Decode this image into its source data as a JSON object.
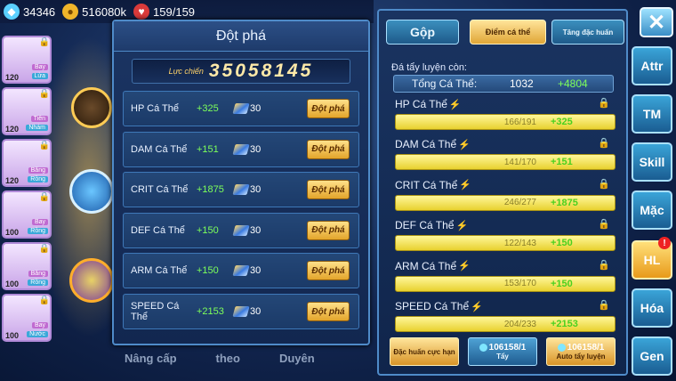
{
  "resources": {
    "gems": "34346",
    "gold": "516080k",
    "stamina": "159/159"
  },
  "pets": [
    {
      "level": "120",
      "tag1": "Bay",
      "tag2": "Lửa"
    },
    {
      "level": "120",
      "tag1": "Tiên",
      "tag2": "Nhám"
    },
    {
      "level": "120",
      "tag1": "Băng",
      "tag2": "Rồng"
    },
    {
      "level": "100",
      "tag1": "Bay",
      "tag2": "Rồng"
    },
    {
      "level": "100",
      "tag1": "Băng",
      "tag2": "Rồng"
    },
    {
      "level": "100",
      "tag1": "Bay",
      "tag2": "Nước"
    }
  ],
  "bottom_tabs": [
    "Nâng cấp",
    "theo",
    "Duyên"
  ],
  "breakthrough": {
    "title": "Đột phá",
    "power_label": "Lực chiến",
    "power_value": "35058145",
    "rows": [
      {
        "name": "HP Cá Thể",
        "bonus": "+325",
        "cost": "30",
        "button": "Đột phá"
      },
      {
        "name": "DAM Cá Thể",
        "bonus": "+151",
        "cost": "30",
        "button": "Đột phá"
      },
      {
        "name": "CRIT Cá Thể",
        "bonus": "+1875",
        "cost": "30",
        "button": "Đột phá"
      },
      {
        "name": "DEF Cá Thể",
        "bonus": "+150",
        "cost": "30",
        "button": "Đột phá"
      },
      {
        "name": "ARM Cá Thể",
        "bonus": "+150",
        "cost": "30",
        "button": "Đột phá"
      },
      {
        "name": "SPEED Cá Thể",
        "bonus": "+2153",
        "cost": "30",
        "button": "Đột phá"
      }
    ]
  },
  "training": {
    "tabs": {
      "gop": "Gộp",
      "diem": "Điểm cá thể",
      "tang": "Tăng đặc huấn"
    },
    "remaining_label": "Đá tẩy luyện còn:",
    "total_label": "Tổng Cá Thể:",
    "total_value": "1032",
    "total_bonus": "+4804",
    "stats": [
      {
        "name": "HP Cá Thể",
        "current": "166/191",
        "bonus": "+325"
      },
      {
        "name": "DAM Cá Thể",
        "current": "141/170",
        "bonus": "+151"
      },
      {
        "name": "CRIT Cá Thể",
        "current": "246/277",
        "bonus": "+1875"
      },
      {
        "name": "DEF Cá Thể",
        "current": "122/143",
        "bonus": "+150"
      },
      {
        "name": "ARM Cá Thể",
        "current": "153/170",
        "bonus": "+150"
      },
      {
        "name": "SPEED Cá Thể",
        "current": "204/233",
        "bonus": "+2153"
      }
    ],
    "buttons": {
      "dac_huan": "Đặc huấn cực hạn",
      "tay_count": "106158/1",
      "tay_label": "Tẩy",
      "auto_count": "106158/1",
      "auto_label": "Auto tẩy luyện"
    }
  },
  "side_menu": [
    "Attr",
    "TM",
    "Skill",
    "Mặc",
    "HL",
    "Hóa",
    "Gen"
  ],
  "hl_badge": "!"
}
